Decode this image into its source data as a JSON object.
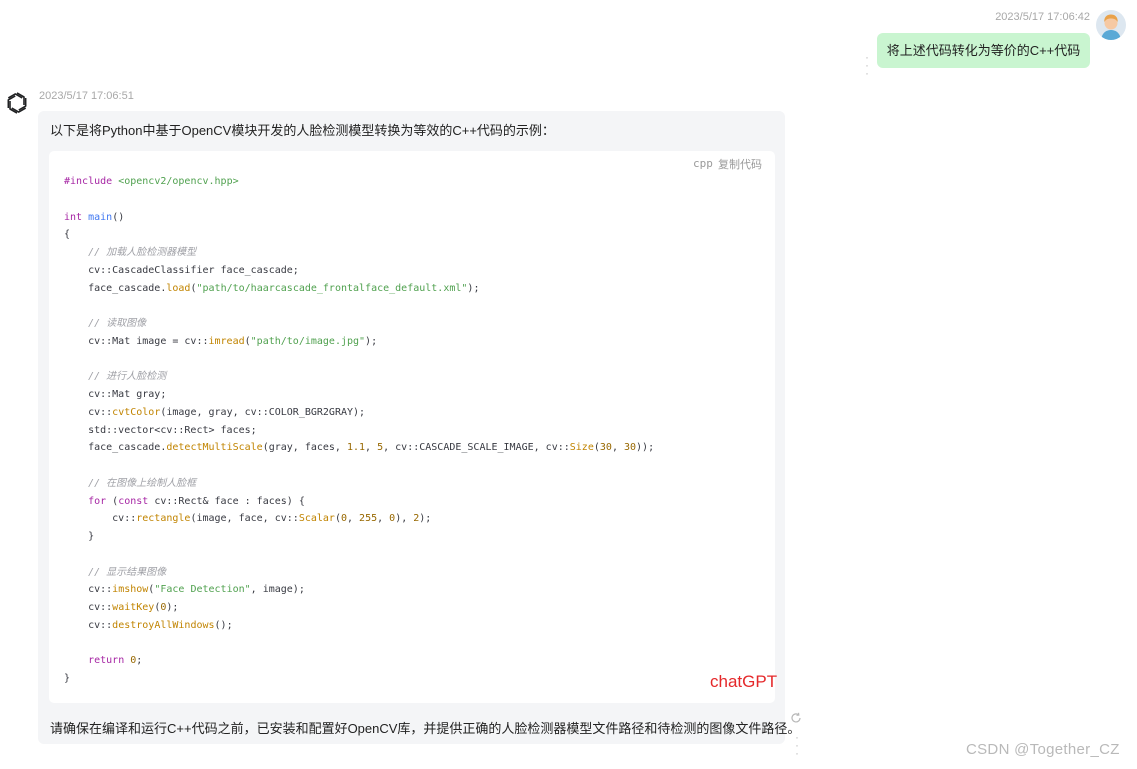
{
  "user_message": {
    "timestamp": "2023/5/17 17:06:42",
    "text": "将上述代码转化为等价的C++代码",
    "avatar_icon": "user-avatar-icon"
  },
  "assistant_message": {
    "timestamp": "2023/5/17 17:06:51",
    "icon": "openai-logo-icon",
    "intro": "以下是将Python中基于OpenCV模块开发的人脸检测模型转换为等效的C++代码的示例：",
    "code_block": {
      "language": "cpp",
      "copy_label": "复制代码",
      "lines": [
        "#include <opencv2/opencv.hpp>",
        "",
        "int main()",
        "{",
        "    // 加载人脸检测器模型",
        "    cv::CascadeClassifier face_cascade;",
        "    face_cascade.load(\"path/to/haarcascade_frontalface_default.xml\");",
        "",
        "    // 读取图像",
        "    cv::Mat image = cv::imread(\"path/to/image.jpg\");",
        "",
        "    // 进行人脸检测",
        "    cv::Mat gray;",
        "    cv::cvtColor(image, gray, cv::COLOR_BGR2GRAY);",
        "    std::vector<cv::Rect> faces;",
        "    face_cascade.detectMultiScale(gray, faces, 1.1, 5, cv::CASCADE_SCALE_IMAGE, cv::Size(30, 30));",
        "",
        "    // 在图像上绘制人脸框",
        "    for (const cv::Rect& face : faces) {",
        "        cv::rectangle(image, face, cv::Scalar(0, 255, 0), 2);",
        "    }",
        "",
        "    // 显示结果图像",
        "    cv::imshow(\"Face Detection\", image);",
        "    cv::waitKey(0);",
        "    cv::destroyAllWindows();",
        "",
        "    return 0;",
        "}"
      ]
    },
    "overlay_label": "chatGPT",
    "note": "请确保在编译和运行C++代码之前，已安装和配置好OpenCV库，并提供正确的人脸检测器模型文件路径和待检测的图像文件路径。"
  },
  "watermark": "CSDN @Together_CZ",
  "colors": {
    "user_bubble": "#c9f5d0",
    "assistant_bubble": "#f4f5f7",
    "code_bg": "#ffffff",
    "overlay_red": "#e5282a"
  }
}
